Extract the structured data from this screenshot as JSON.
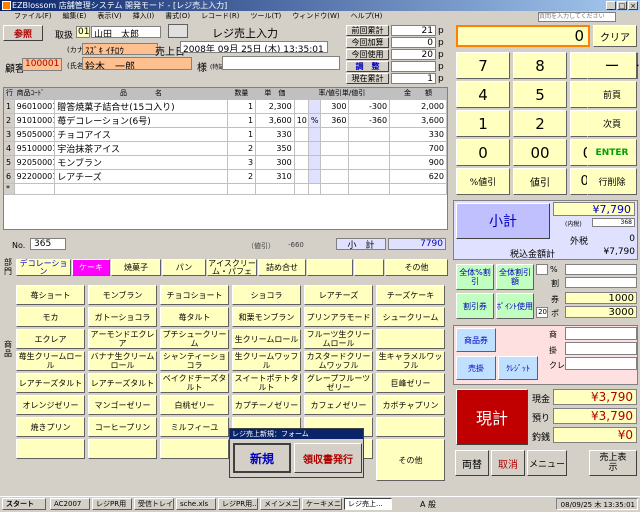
{
  "window": {
    "title": "EZBlossom 店舗管理システム 開発モード - [レジ売上入力]",
    "search_placeholder": "質問を入力してください"
  },
  "menu": [
    "ファイル(F)",
    "編集(E)",
    "表示(V)",
    "挿入(I)",
    "書式(O)",
    "レコード(R)",
    "ツール(T)",
    "ウィンドウ(W)",
    "ヘルプ(H)"
  ],
  "header": {
    "browse": "参照",
    "handler_label": "取扱",
    "handler_code": "01",
    "handler_name": "山田　太郎",
    "form_title": "レジ売上入力",
    "kana_label": "(カナ)",
    "kana": "ｽｽﾞｷ ｲﾁﾛｳ",
    "sales_date_label": "売上日",
    "sales_date": "2008年 09月 25日 (木) 13:35:01",
    "customer_label": "顧客",
    "customer_id": "100001",
    "name_label": "(氏名)",
    "customer_name": "鈴木　一郎",
    "honorific": "様",
    "special_label": "(特記)"
  },
  "points": {
    "rows": [
      {
        "label": "前回累計",
        "value": "21",
        "unit": "p"
      },
      {
        "label": "今回加算",
        "value": "0",
        "unit": "p"
      },
      {
        "label": "今回使用",
        "value": "20",
        "unit": "p"
      },
      {
        "label": "調　整",
        "value": "",
        "unit": "p"
      },
      {
        "label": "現在累計",
        "value": "1",
        "unit": "p"
      }
    ]
  },
  "grid": {
    "headers": {
      "row": "行",
      "code": "商品ｺｰﾄﾞ",
      "name": "品　　　　名",
      "qty": "数量",
      "price": "単　価",
      "discount": "率/値引単/値引",
      "amount": "金　　額"
    },
    "rows": [
      {
        "row": "1",
        "code": "96010001",
        "name": "贈答焼菓子詰合せ(15コ入り)",
        "qty": "1",
        "price": "2,300",
        "rate": "",
        "unit": "",
        "disc_unit": "300",
        "disc": "-300",
        "amount": "2,000"
      },
      {
        "row": "2",
        "code": "91010001",
        "name": "苺デコレーション(6号)",
        "qty": "1",
        "price": "3,600",
        "rate": "10",
        "unit": "%",
        "disc_unit": "360",
        "disc": "-360",
        "amount": "3,600"
      },
      {
        "row": "3",
        "code": "95050001",
        "name": "チョコアイス",
        "qty": "1",
        "price": "330",
        "rate": "",
        "unit": "",
        "disc_unit": "",
        "disc": "",
        "amount": "330"
      },
      {
        "row": "4",
        "code": "95100001",
        "name": "宇治抹茶アイス",
        "qty": "2",
        "price": "350",
        "rate": "",
        "unit": "",
        "disc_unit": "",
        "disc": "",
        "amount": "700"
      },
      {
        "row": "5",
        "code": "92050001",
        "name": "モンブラン",
        "qty": "3",
        "price": "300",
        "rate": "",
        "unit": "",
        "disc_unit": "",
        "disc": "",
        "amount": "900"
      },
      {
        "row": "6",
        "code": "92200001",
        "name": "レアチーズ",
        "qty": "2",
        "price": "310",
        "rate": "",
        "unit": "",
        "disc_unit": "",
        "disc": "",
        "amount": "620"
      },
      {
        "row": "*",
        "code": "",
        "name": "",
        "qty": "",
        "price": "",
        "rate": "",
        "unit": "",
        "disc_unit": "",
        "disc": "",
        "amount": ""
      }
    ]
  },
  "footer": {
    "no_label": "No.",
    "no": "365",
    "discount_note": "（値引）",
    "discount_value": "-660",
    "subtotal_label": "小　計",
    "subtotal": "7790"
  },
  "categories": {
    "side_label": "部門",
    "items": [
      "デコレーション",
      "ケーキ",
      "焼菓子",
      "パン",
      "アイスクリーム・パフェ",
      "詰め合せ",
      "",
      "",
      "その他"
    ]
  },
  "products": {
    "side_label": "商品",
    "rows": [
      [
        "苺ショート",
        "モンブラン",
        "チョコショート",
        "ショコラ",
        "レアチーズ",
        "チーズケーキ"
      ],
      [
        "モカ",
        "ガトーショコラ",
        "苺タルト",
        "和栗モンブラン",
        "プリンアラモード",
        "シュークリーム"
      ],
      [
        "エクレア",
        "アーモンドエクレア",
        "プチシュークリーム",
        "生クリームロール",
        "フルーツ生クリームロール",
        ""
      ],
      [
        "苺生クリームロール",
        "バナナ生クリームロール",
        "シャンティーショコラ",
        "生クリームワッフル",
        "カスタードクリームワッフル",
        "生キャラメルワッフル"
      ],
      [
        "レアチーズタルト",
        "レアチーズタルト",
        "ベイクドチーズタルト",
        "スイートポテトタルト",
        "グレープフルーツゼリー",
        "巨峰ゼリー"
      ],
      [
        "オレンジゼリー",
        "マンゴーゼリー",
        "白桃ゼリー",
        "カプチーノゼリー",
        "カフェノゼリー",
        "カボチャプリン"
      ],
      [
        "焼きプリン",
        "コーヒープリン",
        "ミルフィーユ",
        "",
        "",
        ""
      ],
      [
        "",
        "",
        "",
        "",
        "",
        "その他"
      ]
    ]
  },
  "popup": {
    "title": "レジ売上新規：フォーム",
    "new": "新規",
    "receipt": "領収書発行"
  },
  "keypad": {
    "display": "0",
    "clear": "クリア",
    "rows": [
      [
        "7",
        "8",
        "9",
        "ー"
      ],
      [
        "4",
        "5",
        "6",
        "前頁"
      ],
      [
        "1",
        "2",
        "3",
        "次頁"
      ],
      [
        "0",
        "00",
        "000",
        "ENTER"
      ],
      [
        "%値引",
        "値引",
        "0000",
        "行削除"
      ]
    ]
  },
  "totals": {
    "subtotal_btn": "小計",
    "subtotal_value": "¥7,790",
    "tax_note": "(内税)",
    "tax_value": "368",
    "outside_label": "外税",
    "outside_value": "0",
    "with_tax_label": "税込金額計",
    "with_tax_value": "¥7,790"
  },
  "discount_panel": {
    "all_pct": "全体%割引",
    "all_amount": "全体割引額",
    "pct_unit": "%",
    "coupon_label": "割",
    "vouchers": "割引券",
    "use_points": "ﾎﾟｲﾝﾄ使用",
    "ken_label": "券",
    "ken_value": "1000",
    "pts_qty": "20",
    "pts_label": "ポ",
    "pts_value": "3000"
  },
  "payment": {
    "gift": "商品券",
    "credit_sale": "売掛",
    "credit": "ｸﾚｼﾞｯﾄ",
    "gift_label": "商",
    "credit_sale_label": "掛",
    "credit_label": "クレ"
  },
  "settle": {
    "label": "現計",
    "cash_label": "現金",
    "cash": "¥3,790",
    "deposit_label": "預り",
    "deposit": "¥3,790",
    "change_label": "釣銭",
    "change": "¥0"
  },
  "bottom_buttons": {
    "exchange": "両替",
    "cancel": "取消",
    "menu": "メニュー",
    "sales_view": "売上表示"
  },
  "taskbar": {
    "start": "スタート",
    "items": [
      "AC2007",
      "レジPR用",
      "受信トレイ...",
      "sche.xls",
      "レジPR用...",
      "メインメニ...",
      "ケーキメニ...",
      "レジ売上..."
    ],
    "tray_ime": "A 般",
    "time": "08/09/25 木 13:35:01"
  },
  "colors": {
    "accent_red": "#b00000",
    "blue_cat": "#0000c0",
    "pink": "#ff00ff",
    "grid_header": "#c0c0c0"
  }
}
